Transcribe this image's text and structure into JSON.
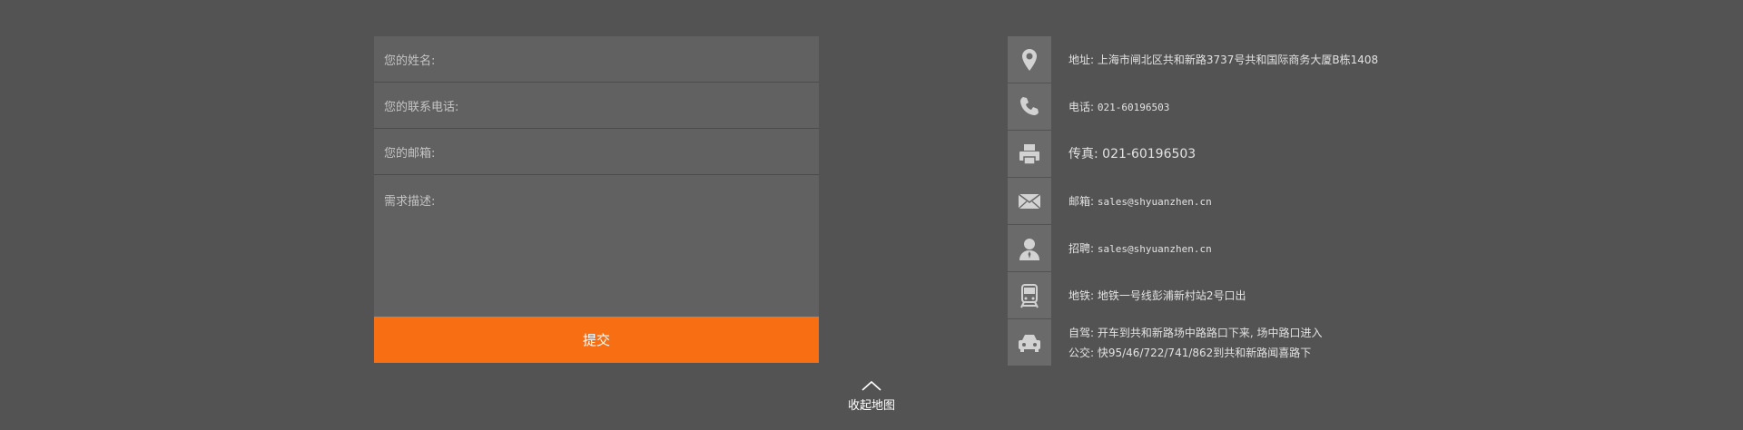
{
  "form": {
    "name_label": "您的姓名:",
    "phone_label": "您的联系电话:",
    "email_label": "您的邮箱:",
    "desc_label": "需求描述:",
    "submit_label": "提交"
  },
  "contact": {
    "address": "地址: 上海市闸北区共和新路3737号共和国际商务大厦B栋1408",
    "phone_prefix": "电话: ",
    "phone": "021-60196503",
    "fax_prefix": "传真: ",
    "fax": "021-60196503",
    "email_prefix": "邮箱: ",
    "email": "sales@shyuanzhen.cn",
    "recruit_prefix": "招聘: ",
    "recruit": "sales@shyuanzhen.cn",
    "subway": "地铁: 地铁一号线彭浦新村站2号口出",
    "drive": "自驾: 开车到共和新路场中路路口下来, 场中路口进入",
    "bus": "公交: 快95/46/722/741/862到共和新路闻喜路下"
  },
  "toggle": {
    "label": "收起地图"
  },
  "icons": {
    "address": "map-pin-icon",
    "phone": "phone-icon",
    "fax": "printer-icon",
    "email": "envelope-icon",
    "recruit": "person-icon",
    "subway": "train-icon",
    "drive": "car-icon",
    "toggle": "chevron-up-icon"
  },
  "colors": {
    "background": "#535353",
    "submit": "#f76f12",
    "field": "#616161",
    "icon_box": "#6a6a6a"
  }
}
